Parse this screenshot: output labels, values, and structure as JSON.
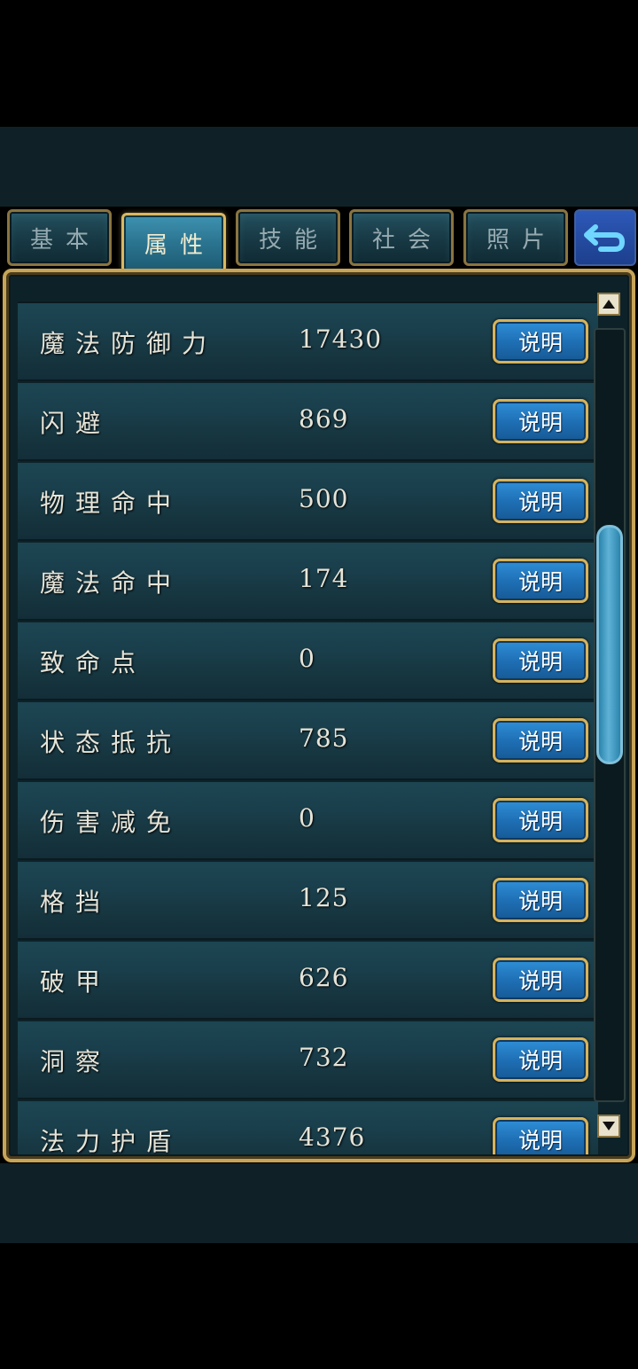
{
  "tabs": [
    {
      "label": "基本",
      "active": false
    },
    {
      "label": "属性",
      "active": true
    },
    {
      "label": "技能",
      "active": false
    },
    {
      "label": "社会",
      "active": false
    },
    {
      "label": "照片",
      "active": false
    }
  ],
  "back_icon": "return-arrow-icon",
  "button_label": "说明",
  "rows": [
    {
      "name": "魔法防御力",
      "value": "17430"
    },
    {
      "name": "闪避",
      "value": "869"
    },
    {
      "name": "物理命中",
      "value": "500"
    },
    {
      "name": "魔法命中",
      "value": "174"
    },
    {
      "name": "致命点",
      "value": "0"
    },
    {
      "name": "状态抵抗",
      "value": "785"
    },
    {
      "name": "伤害减免",
      "value": "0"
    },
    {
      "name": "格挡",
      "value": "125"
    },
    {
      "name": "破甲",
      "value": "626"
    },
    {
      "name": "洞察",
      "value": "732"
    },
    {
      "name": "法力护盾",
      "value": "4376"
    }
  ],
  "scroll": {
    "position": 0.45
  },
  "colors": {
    "panel_border": "#c6a458",
    "button_blue": "#1f70b6",
    "row_bg": "#1a3f4c"
  }
}
